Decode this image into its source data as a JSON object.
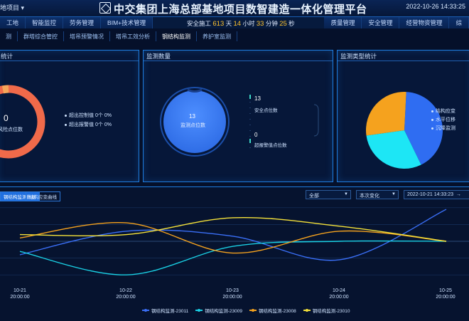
{
  "header": {
    "project_select": "地项目 ▾",
    "title": "中交集团上海总部基地项目数智建造一体化管理平台",
    "datetime": "2022-10-26 14:33:25"
  },
  "nav": {
    "left": [
      "工地",
      "智能监控",
      "劳务管理",
      "BIM+技术管理"
    ],
    "right": [
      "质量管理",
      "安全管理",
      "经营物资管理",
      "综"
    ],
    "safety": {
      "prefix": "安全施工",
      "days": "613",
      "days_unit": "天",
      "hours": "14",
      "hours_unit": "小时",
      "minutes": "33",
      "minutes_unit": "分钟",
      "seconds": "25",
      "seconds_unit": "秒"
    }
  },
  "subtabs": [
    "测",
    "群塔综合管控",
    "塔吊预警情况",
    "塔吊工效分析",
    "钢结构监测",
    "养护室监测"
  ],
  "panel1": {
    "title": "统计",
    "center_value": "0",
    "center_label": "风险点位数",
    "items": [
      {
        "label": "超出控制值",
        "count": "0个",
        "pct": "0%"
      },
      {
        "label": "超出报警值",
        "count": "0个",
        "pct": "0%"
      }
    ],
    "ring_color": "#f06a4a",
    "ring_accent": "#f5a65a"
  },
  "panel2": {
    "title": "监测数量",
    "center_value": "13",
    "center_label": "监测点位数",
    "stats": [
      {
        "value": "13",
        "label": "安全点位数"
      },
      {
        "value": "0",
        "label": "超报警值点位数"
      }
    ]
  },
  "panel3": {
    "title": "监测类型统计",
    "legend": [
      "结构应变",
      "水平位移",
      "沉降监测"
    ],
    "slices": [
      {
        "value": 42,
        "color": "#2f6df2"
      },
      {
        "value": 30,
        "color": "#1de6f5"
      },
      {
        "value": 28,
        "color": "#f5a21e"
      }
    ]
  },
  "bottom": {
    "tabs": [
      "钢结构监测数据",
      "结构应变曲线"
    ],
    "select_scope": "全部",
    "select_mode": "本次变化",
    "range_start": "2022-10-21 14:33:23",
    "range_arrow": "→"
  },
  "chart_data": {
    "type": "line",
    "x": [
      "10-21 20:00:00",
      "10-22 20:00:00",
      "10-23 20:00:00",
      "10-24 20:00:00",
      "10-25 20:00:00"
    ],
    "series": [
      {
        "name": "钢结构监测-23011",
        "color": "#3a6ff7",
        "values": [
          -0.8,
          0.6,
          0.3,
          -1.1,
          1.9
        ]
      },
      {
        "name": "钢结构监测-23009",
        "color": "#1ad1e5",
        "values": [
          -0.6,
          -2.0,
          -0.3,
          0.0,
          0.0
        ]
      },
      {
        "name": "钢结构监测-23008",
        "color": "#f5a21e",
        "values": [
          0.2,
          1.1,
          -0.7,
          0.6,
          0.0
        ]
      },
      {
        "name": "钢结构监测-23010",
        "color": "#f5e23a",
        "values": [
          0.4,
          0.4,
          1.4,
          0.9,
          0.0
        ]
      }
    ],
    "ylim": [
      -2.5,
      2.5
    ],
    "grid": true,
    "legend_position": "bottom"
  }
}
